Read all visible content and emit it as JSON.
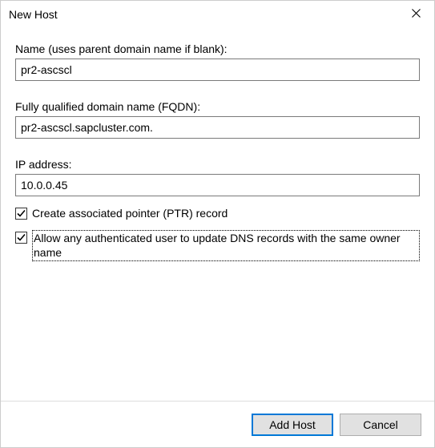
{
  "window": {
    "title": "New Host"
  },
  "fields": {
    "name_label": "Name (uses parent domain name if blank):",
    "name_value": "pr2-ascscl",
    "fqdn_label": "Fully qualified domain name (FQDN):",
    "fqdn_value": "pr2-ascscl.sapcluster.com.",
    "ip_label": "IP address:",
    "ip_value": "10.0.0.45"
  },
  "checkboxes": {
    "ptr_label": "Create associated pointer (PTR) record",
    "ptr_checked": true,
    "allow_update_label": "Allow any authenticated user to update DNS records with the same owner name",
    "allow_update_checked": true
  },
  "buttons": {
    "add_host": "Add Host",
    "cancel": "Cancel"
  }
}
